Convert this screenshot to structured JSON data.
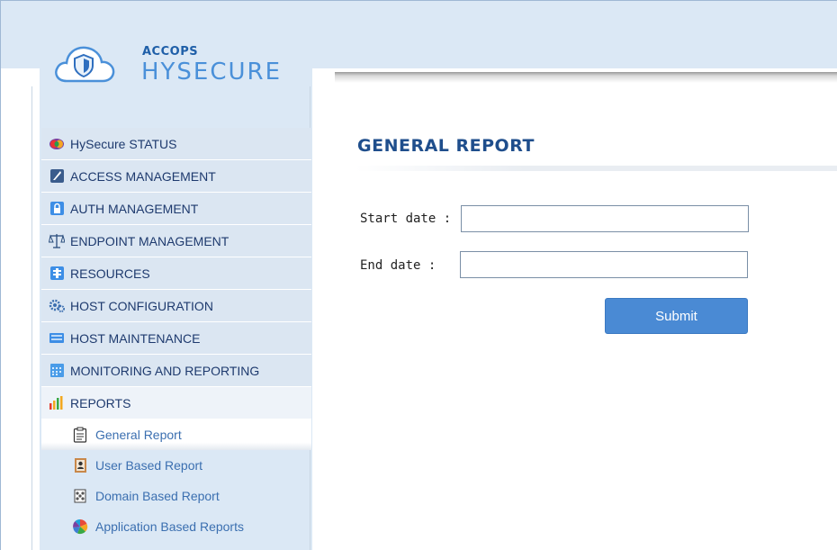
{
  "logo": {
    "brand": "ACCOPS",
    "product": "HYSECURE"
  },
  "nav": {
    "items": [
      {
        "label": "HySecure STATUS",
        "icon": "status-orb-icon"
      },
      {
        "label": "ACCESS MANAGEMENT",
        "icon": "access-shield-icon"
      },
      {
        "label": "AUTH MANAGEMENT",
        "icon": "padlock-icon"
      },
      {
        "label": "ENDPOINT MANAGEMENT",
        "icon": "scales-icon"
      },
      {
        "label": "RESOURCES",
        "icon": "resources-icon"
      },
      {
        "label": "HOST CONFIGURATION",
        "icon": "gears-icon"
      },
      {
        "label": "HOST MAINTENANCE",
        "icon": "maintenance-icon"
      },
      {
        "label": "MONITORING AND REPORTING",
        "icon": "calendar-grid-icon"
      },
      {
        "label": "REPORTS",
        "icon": "bar-chart-icon"
      }
    ],
    "reports_sub": [
      {
        "label": "General Report",
        "icon": "clipboard-icon",
        "active": true
      },
      {
        "label": "User Based Report",
        "icon": "user-book-icon"
      },
      {
        "label": "Domain Based Report",
        "icon": "domain-icon"
      },
      {
        "label": "Application Based Reports",
        "icon": "pie-icon"
      }
    ]
  },
  "main": {
    "title": "GENERAL REPORT",
    "start_label": "Start date :",
    "end_label": "End date :",
    "start_value": "",
    "end_value": "",
    "submit_label": "Submit"
  },
  "colors": {
    "header_bg": "#dbe8f5",
    "nav_text": "#1e3a6e",
    "sub_text": "#3b6fb0",
    "title": "#1f4e8c",
    "button": "#4a8ad4"
  }
}
